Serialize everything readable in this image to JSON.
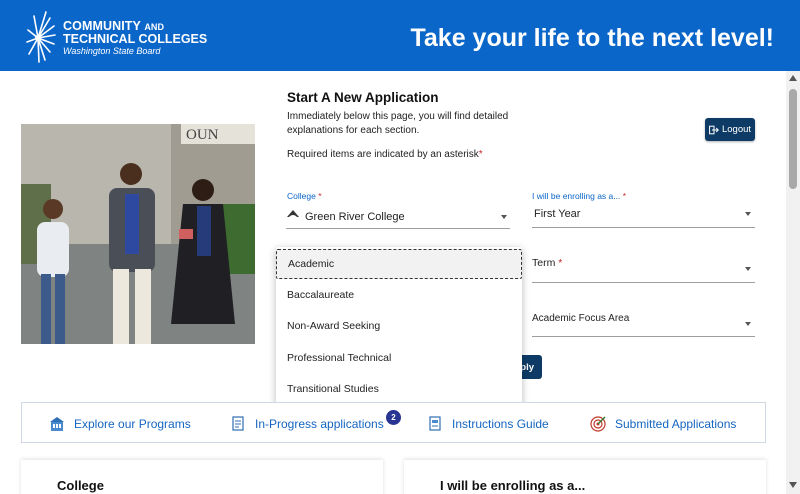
{
  "header": {
    "logo_line1": "COMMUNITY",
    "logo_line1_small": "AND",
    "logo_line2": "TECHNICAL COLLEGES",
    "logo_line3": "Washington State Board",
    "tagline": "Take your life to the next level!"
  },
  "form": {
    "title": "Start A New Application",
    "description": "Immediately below this page, you will find detailed explanations for each section.",
    "required_note": "Required items are indicated by an asterisk",
    "required_star": "*",
    "logout_label": "Logout",
    "college": {
      "label": "College",
      "value": "Green River College"
    },
    "enrolling": {
      "label": "I will be enrolling as a...",
      "value": "First Year"
    },
    "term": {
      "label": "Term"
    },
    "focus_area": {
      "label": "Academic Focus Area"
    },
    "apply_label": "ply"
  },
  "dropdown": {
    "options": [
      "Academic",
      "Baccalaureate",
      "Non-Award Seeking",
      "Professional Technical",
      "Transitional Studies"
    ],
    "highlighted": "Academic"
  },
  "tabs": [
    {
      "label": "Explore our Programs",
      "icon": "building-icon"
    },
    {
      "label": "In-Progress applications",
      "icon": "document-icon",
      "badge": "2"
    },
    {
      "label": "Instructions Guide",
      "icon": "guide-icon"
    },
    {
      "label": "Submitted Applications",
      "icon": "target-icon"
    }
  ],
  "cards": {
    "left_title": "College",
    "right_title": "I will be enrolling as a..."
  },
  "colors": {
    "header_blue": "#0a66c9",
    "button_navy": "#0d3b66",
    "link_blue": "#1565c0",
    "required_red": "#c62828"
  }
}
